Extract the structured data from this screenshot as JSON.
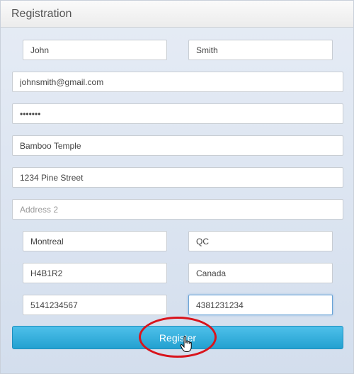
{
  "header": {
    "title": "Registration"
  },
  "form": {
    "first_name": "John",
    "last_name": "Smith",
    "email": "johnsmith@gmail.com",
    "password": "•••••••",
    "address1_company": "Bamboo Temple",
    "address_street": "1234 Pine Street",
    "address2_placeholder": "Address 2",
    "city": "Montreal",
    "province": "QC",
    "postal_code": "H4B1R2",
    "country": "Canada",
    "phone1": "5141234567",
    "phone2": "4381231234",
    "register_label": "Register"
  },
  "colors": {
    "button": "#23a1d0",
    "highlight_oval": "#d9141c"
  }
}
